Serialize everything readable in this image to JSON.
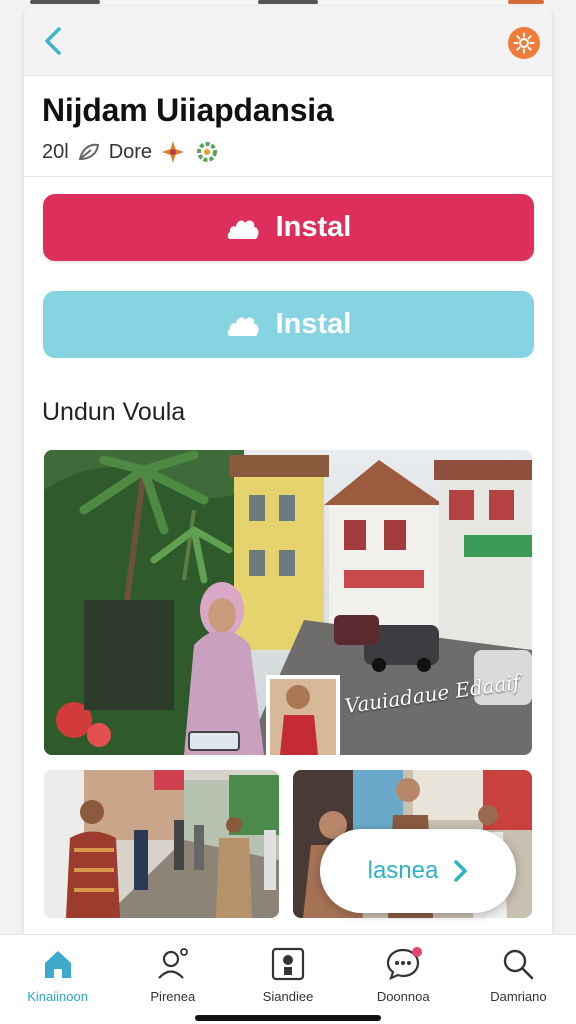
{
  "header": {
    "title": "Nijdam Uiiapdansia",
    "meta_number": "20l",
    "meta_text": "Dore"
  },
  "actions": {
    "primary_label": "Instal",
    "secondary_label": "Instal"
  },
  "section": {
    "title": "Undun Voula"
  },
  "gallery": {
    "main_caption": "Vauiadaue Edaaif",
    "cta_label": "lasnea"
  },
  "tabs": [
    {
      "label": "Kinaiinoon",
      "icon": "home-icon"
    },
    {
      "label": "Pirenea",
      "icon": "profile-icon"
    },
    {
      "label": "Siandiee",
      "icon": "id-card-icon"
    },
    {
      "label": "Doonnoa",
      "icon": "chat-icon"
    },
    {
      "label": "Damriano",
      "icon": "search-icon"
    }
  ],
  "colors": {
    "primary": "#de2e5b",
    "secondary": "#86d4e2",
    "accent": "#2aa9c7",
    "settings": "#f07b3a"
  }
}
